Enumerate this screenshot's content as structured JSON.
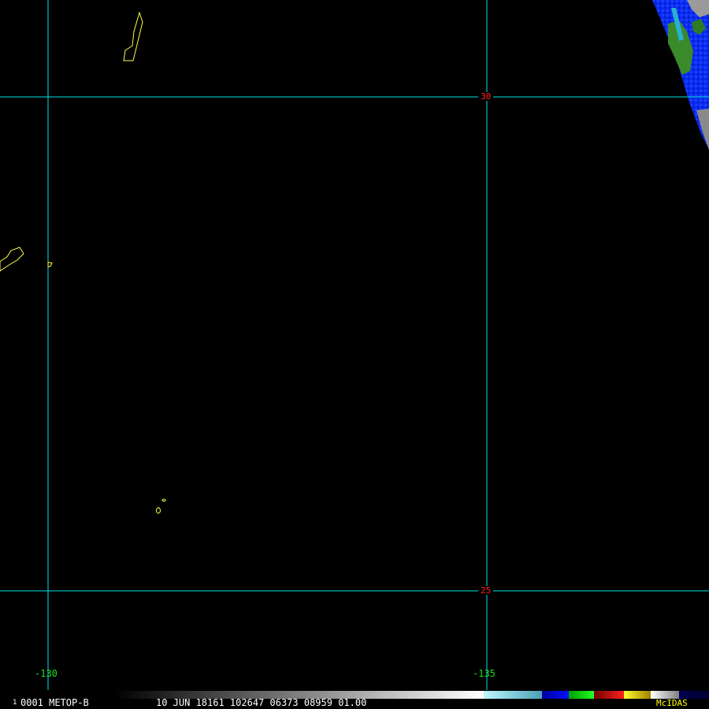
{
  "map": {
    "background_color": "#000000",
    "grid_color": "#00e5e5",
    "coastline_color": "#ffff44",
    "lat_label_color": "#ff2020",
    "lon_label_color": "#22dd22",
    "latitudes": [
      {
        "label": "30"
      },
      {
        "label": "25"
      }
    ],
    "longitudes": [
      {
        "label": "-130"
      },
      {
        "label": "-135"
      }
    ]
  },
  "status_bar": {
    "frame_number": "1",
    "info_text": "0001 METOP-B",
    "timestamp_text": "10 JUN 18161 102647 06373 08959 01.00",
    "text_color": "#ffffff",
    "logo_text": "McIDAS",
    "logo_color": "#ffff00"
  }
}
